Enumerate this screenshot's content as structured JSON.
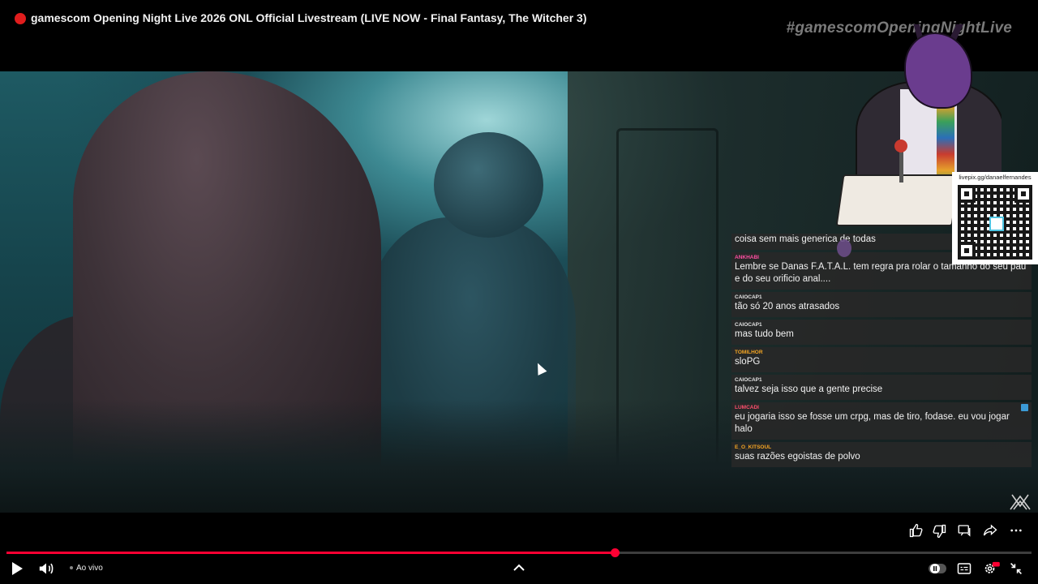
{
  "header": {
    "title": "gamescom Opening Night Live 2026 ONL Official Livestream (LIVE NOW - Final Fantasy, The Witcher 3)",
    "hashtag": "#gamescomOpeningNightLive"
  },
  "overlay": {
    "qr_url": "livepix.gg/danaelfernandes"
  },
  "chat": {
    "messages": [
      {
        "user": "",
        "text": "coisa sem mais generica de todas",
        "user_color": "#e4e4e4"
      },
      {
        "user": "ANKHABI",
        "text": "Lembre se Danas F.A.T.A.L. tem regra pra rolar o tamanho do seu pau e do seu orificio anal....",
        "user_color": "#ff4fa3"
      },
      {
        "user": "CAIOCAP1",
        "text": "tão só 20 anos atrasados",
        "user_color": "#e4e4e4"
      },
      {
        "user": "CAIOCAP1",
        "text": "mas tudo bem",
        "user_color": "#e4e4e4"
      },
      {
        "user": "TOMILHOR",
        "text": "sloPG",
        "user_color": "#f5a623"
      },
      {
        "user": "CAIOCAP1",
        "text": "talvez seja isso que a gente precise",
        "user_color": "#e4e4e4"
      },
      {
        "user": "LUMCADI",
        "text": "eu jogaria isso se fosse um crpg, mas de tiro, fodase. eu vou jogar halo",
        "user_color": "#ff4f6d"
      },
      {
        "user": "E_O_KITSOUL",
        "text": "suas razões egoistas de polvo",
        "user_color": "#f5a623"
      }
    ]
  },
  "player": {
    "live_label": "Ao vivo",
    "progress": 0.594,
    "accent_color": "#ff0033",
    "icons": [
      "play-icon",
      "volume-icon",
      "chevron-up-icon",
      "pause-autoplay-icon",
      "captions-icon",
      "settings-icon",
      "exit-fullscreen-icon",
      "like-icon",
      "dislike-icon",
      "chat-icon",
      "share-icon",
      "more-icon"
    ]
  }
}
